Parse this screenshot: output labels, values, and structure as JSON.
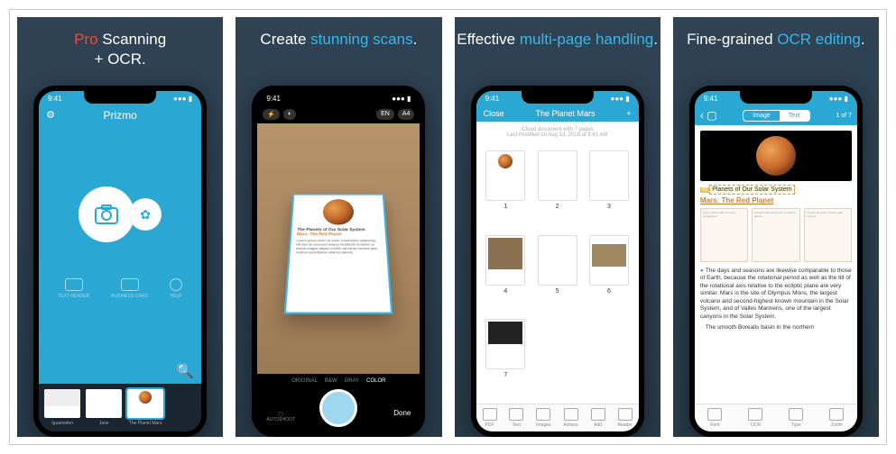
{
  "statusTime": "9:41",
  "panels": [
    {
      "titleParts": {
        "pre": "",
        "accent1": "Pro",
        "mid": " Scanning",
        "line2": "+ OCR."
      }
    },
    {
      "titleParts": {
        "pre": "Create ",
        "accent2": "stunning scans",
        "suffix": "."
      }
    },
    {
      "titleParts": {
        "pre": "Effective ",
        "accent2": "multi-page handling",
        "suffix": "."
      }
    },
    {
      "titleParts": {
        "pre": "Fine-grained ",
        "accent2": "OCR editing",
        "suffix": "."
      }
    }
  ],
  "home": {
    "appName": "Prizmo",
    "tools": [
      "TEXT READER",
      "BUSINESS CARD",
      "HELP"
    ],
    "thumbs": [
      {
        "label": "Iguanodon"
      },
      {
        "label": "Jane"
      },
      {
        "label": "The Planet Mars"
      }
    ]
  },
  "camera": {
    "badges": [
      "EN",
      "A4"
    ],
    "docTitle": "The Planets of Our Solar System",
    "docSubtitle": "Mars: The Red Planet",
    "modes": [
      "ORIGINAL",
      "B&W",
      "GRAY",
      "COLOR"
    ],
    "auto": "AUTOSHOOT",
    "done": "Done"
  },
  "pages": {
    "close": "Close",
    "title": "The Planet Mars",
    "info1": "iCloud document with 7 pages",
    "info2": "Last modified on Aug 13, 2018 at 9:41 AM",
    "nums": [
      "1",
      "2",
      "3",
      "4",
      "5",
      "6",
      "7"
    ],
    "toolbar": [
      "PDF",
      "Text",
      "Images",
      "Actions",
      "Add",
      "Reader"
    ]
  },
  "ocr": {
    "segImage": "Image",
    "segText": "Text",
    "pageCount": "1 of 7",
    "h1": "Planets of Our Solar System",
    "h2": "Mars: The Red Planet",
    "para": "The days and seasons are likewise comparable to those of Earth, because the rotational period as well as the tilt of the rotational axis relative to the ecliptic plane are very similar. Mars is the site of Olympus Mons, the largest volcano and second-highest known mountain in the Solar System, and of Valles Marineris, one of the largest canyons in the Solar System.",
    "para2": "The smooth Borealis basin in the northern",
    "toolbar": [
      "Font",
      "OCR",
      "Type",
      "Zoom"
    ]
  }
}
